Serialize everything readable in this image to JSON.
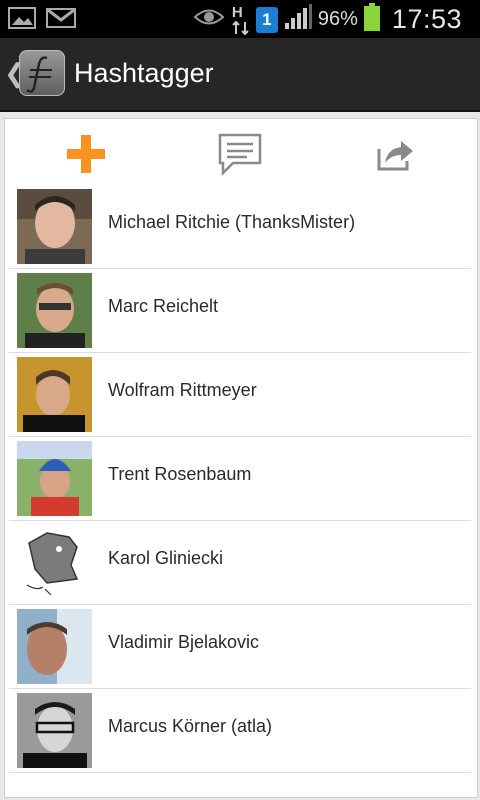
{
  "status_bar": {
    "battery_percent": "96%",
    "time": "17:53",
    "network_type": "H",
    "notification_badge": "1"
  },
  "action_bar": {
    "title": "Hashtagger"
  },
  "toolbar": {
    "add_icon": "plus-icon",
    "comment_icon": "comment-icon",
    "share_icon": "share-icon",
    "accent_color": "#f7931e"
  },
  "people": [
    {
      "name": "Michael Ritchie (ThanksMister)"
    },
    {
      "name": "Marc Reichelt"
    },
    {
      "name": "Wolfram Rittmeyer"
    },
    {
      "name": "Trent Rosenbaum"
    },
    {
      "name": "Karol Gliniecki"
    },
    {
      "name": "Vladimir Bjelakovic"
    },
    {
      "name": "Marcus Körner (atla)"
    }
  ]
}
